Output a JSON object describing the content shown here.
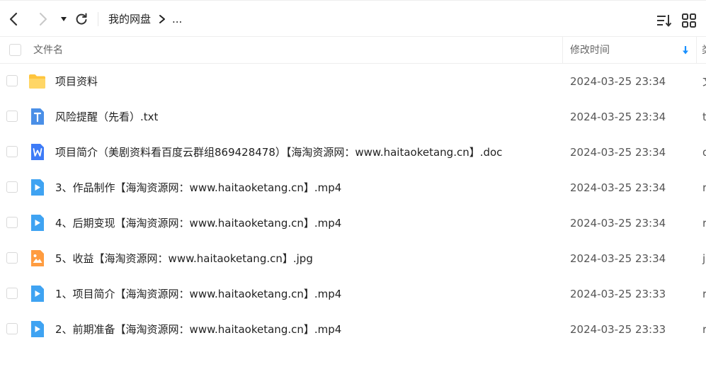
{
  "breadcrumb": {
    "root": "我的网盘",
    "more": "..."
  },
  "header": {
    "name_label": "文件名",
    "time_label": "修改时间",
    "type_label": "类"
  },
  "files": [
    {
      "name": "项目资料",
      "time": "2024-03-25 23:34",
      "type": "文",
      "icon": "folder-icon"
    },
    {
      "name": "风险提醒（先看）.txt",
      "time": "2024-03-25 23:34",
      "type": "t",
      "icon": "text-file-icon"
    },
    {
      "name": "项目简介（美剧资料看百度云群组869428478）【海淘资源网：www.haitaoketang.cn】.doc",
      "time": "2024-03-25 23:34",
      "type": "d",
      "icon": "word-file-icon"
    },
    {
      "name": "3、作品制作【海淘资源网：www.haitaoketang.cn】.mp4",
      "time": "2024-03-25 23:34",
      "type": "r",
      "icon": "video-file-icon"
    },
    {
      "name": "4、后期变现【海淘资源网：www.haitaoketang.cn】.mp4",
      "time": "2024-03-25 23:34",
      "type": "r",
      "icon": "video-file-icon"
    },
    {
      "name": "5、收益【海淘资源网：www.haitaoketang.cn】.jpg",
      "time": "2024-03-25 23:34",
      "type": "j",
      "icon": "image-file-icon"
    },
    {
      "name": "1、项目简介【海淘资源网：www.haitaoketang.cn】.mp4",
      "time": "2024-03-25 23:33",
      "type": "r",
      "icon": "video-file-icon"
    },
    {
      "name": "2、前期准备【海淘资源网：www.haitaoketang.cn】.mp4",
      "time": "2024-03-25 23:33",
      "type": "r",
      "icon": "video-file-icon"
    }
  ],
  "colors": {
    "folder": "#FFC53D",
    "text_file": "#4A8FE7",
    "word_file": "#3D7BF7",
    "video_file": "#3FA3F2",
    "image_file": "#FF9C40",
    "sort_accent": "#1890FF"
  }
}
